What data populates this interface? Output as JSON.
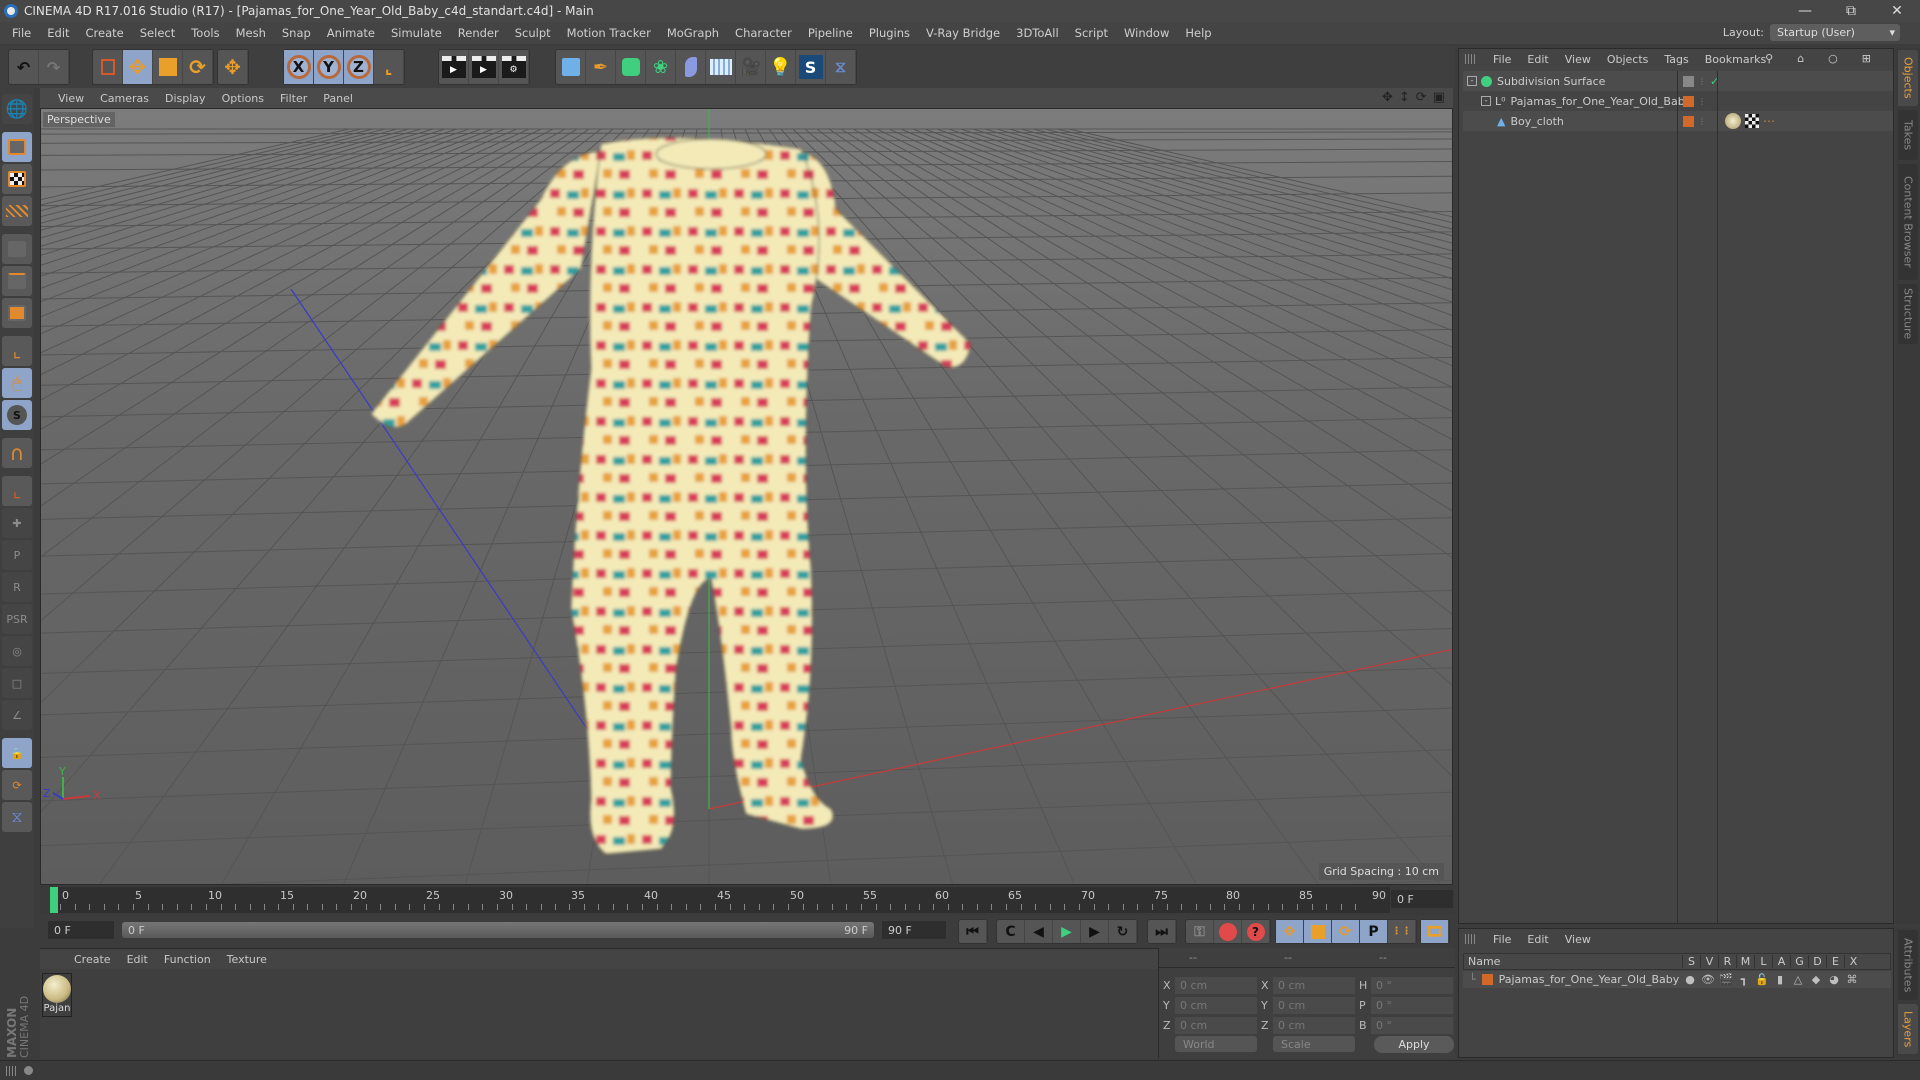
{
  "window": {
    "title": "CINEMA 4D R17.016 Studio (R17) - [Pajamas_for_One_Year_Old_Baby_c4d_standart.c4d] - Main",
    "controls": [
      "minimize",
      "restore",
      "close"
    ]
  },
  "menubar": [
    "File",
    "Edit",
    "Create",
    "Select",
    "Tools",
    "Mesh",
    "Snap",
    "Animate",
    "Simulate",
    "Render",
    "Sculpt",
    "Motion Tracker",
    "MoGraph",
    "Character",
    "Pipeline",
    "Plugins",
    "V-Ray Bridge",
    "3DToAll",
    "Script",
    "Window",
    "Help"
  ],
  "layout": {
    "label": "Layout:",
    "value": "Startup (User)"
  },
  "toolbar": {
    "undo": "undo-icon",
    "redo": "redo-icon",
    "axis_x": "X",
    "axis_y": "Y",
    "axis_z": "Z"
  },
  "viewport": {
    "menu": [
      "View",
      "Cameras",
      "Display",
      "Options",
      "Filter",
      "Panel"
    ],
    "camera_label": "Perspective",
    "grid_spacing": "Grid Spacing : 10 cm",
    "axis_labels": {
      "x": "X",
      "y": "Y",
      "z": "Z"
    },
    "colors": {
      "x_axis": "#c83a3a",
      "y_axis": "#3fb04a",
      "z_axis": "#3a3ac8",
      "cloth_base": "#f3eab8"
    }
  },
  "timeline": {
    "ticks": [
      "0",
      "5",
      "10",
      "15",
      "20",
      "25",
      "30",
      "35",
      "40",
      "45",
      "50",
      "55",
      "60",
      "65",
      "70",
      "75",
      "80",
      "85",
      "90"
    ],
    "current_frame": "0 F",
    "start_field": "0 F",
    "range_start": "0 F",
    "range_end": "90 F",
    "end_field": "90 F"
  },
  "material_manager": {
    "menu": [
      "Create",
      "Edit",
      "Function",
      "Texture"
    ],
    "materials": [
      {
        "name": "Pajan"
      }
    ]
  },
  "branding": {
    "maxon": "MAXON",
    "product": "CINEMA 4D"
  },
  "coordinates": {
    "headers": [
      "--",
      "--",
      "--"
    ],
    "rows": [
      {
        "pos_label": "X",
        "pos": "0 cm",
        "size_label": "X",
        "size": "0 cm",
        "rot_label": "H",
        "rot": "0 °"
      },
      {
        "pos_label": "Y",
        "pos": "0 cm",
        "size_label": "Y",
        "size": "0 cm",
        "rot_label": "P",
        "rot": "0 °"
      },
      {
        "pos_label": "Z",
        "pos": "0 cm",
        "size_label": "Z",
        "size": "0 cm",
        "rot_label": "B",
        "rot": "0 °"
      }
    ],
    "space_select": "World",
    "mode_select": "Scale",
    "apply_label": "Apply"
  },
  "object_manager": {
    "menu": [
      "File",
      "Edit",
      "View",
      "Objects",
      "Tags",
      "Bookmarks"
    ],
    "objects": [
      {
        "name": "Subdivision Surface",
        "depth": 0,
        "icon": "subdivision-surface-icon"
      },
      {
        "name": "Pajamas_for_One_Year_Old_Baby",
        "depth": 1,
        "icon": "null-object-icon"
      },
      {
        "name": "Boy_cloth",
        "depth": 2,
        "icon": "polygon-object-icon"
      }
    ]
  },
  "right_tabs_top": [
    {
      "label": "Objects",
      "active": true
    },
    {
      "label": "Takes",
      "active": false
    },
    {
      "label": "Content Browser",
      "active": false
    },
    {
      "label": "Structure",
      "active": false
    }
  ],
  "right_tabs_bottom": [
    {
      "label": "Attributes",
      "active": false
    },
    {
      "label": "Layers",
      "active": true
    }
  ],
  "layer_manager": {
    "menu": [
      "File",
      "Edit",
      "View"
    ],
    "columns": [
      "Name",
      "S",
      "V",
      "R",
      "M",
      "L",
      "A",
      "G",
      "D",
      "E",
      "X"
    ],
    "layers": [
      {
        "name": "Pajamas_for_One_Year_Old_Baby",
        "color": "#d2692a"
      }
    ]
  }
}
